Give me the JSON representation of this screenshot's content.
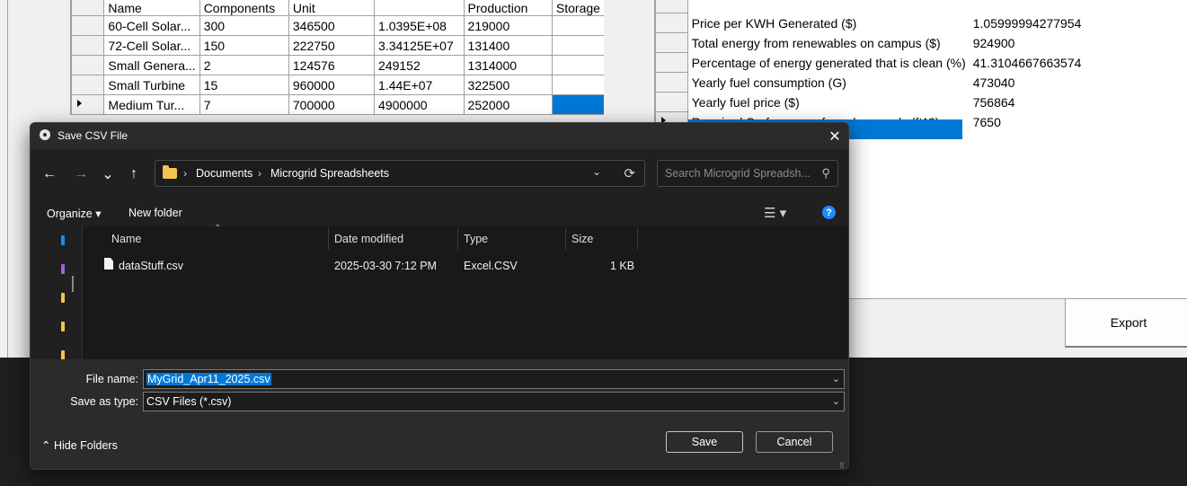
{
  "app": {
    "components_table": {
      "headers": [
        "",
        "Name",
        "Components",
        "Unit",
        "",
        "Production",
        "Storage"
      ],
      "rows": [
        [
          "60-Cell Solar...",
          "300",
          "346500",
          "1.0395E+08",
          "219000",
          ""
        ],
        [
          "72-Cell Solar...",
          "150",
          "222750",
          "3.34125E+07",
          "131400",
          ""
        ],
        [
          "Small Genera...",
          "2",
          "124576",
          "249152",
          "1314000",
          ""
        ],
        [
          "Small Turbine",
          "15",
          "960000",
          "1.44E+07",
          "322500",
          ""
        ],
        [
          "Medium Tur...",
          "7",
          "700000",
          "4900000",
          "252000",
          ""
        ]
      ],
      "current_row_index": 4
    },
    "stats_table": {
      "rows": [
        [
          "Price per KWH Generated ($)",
          "1.05999994277954"
        ],
        [
          "Total energy from renewables on campus ($)",
          "924900"
        ],
        [
          "Percentage of energy generated that is clean (%)",
          "41.3104667663574"
        ],
        [
          "Yearly fuel consumption (G)",
          "473040"
        ],
        [
          "Yearly fuel price ($)",
          "756864"
        ],
        [
          "Required Surface area for solar panels (ft^2)",
          "7650"
        ]
      ],
      "current_row_index": 5
    },
    "export_label": "Export"
  },
  "dialog": {
    "title": "Save CSV File",
    "close_glyph": "✕",
    "nav": {
      "back": "←",
      "forward": "→",
      "recent": "⌄",
      "up": "↑"
    },
    "breadcrumb": [
      "Documents",
      "Microgrid Spreadsheets"
    ],
    "breadcrumb_sep": "›",
    "search_placeholder": "Search Microgrid Spreadsh...",
    "toolbar": {
      "organize": "Organize ▾",
      "new_folder": "New folder",
      "help": "?"
    },
    "columns": {
      "name": "Name",
      "date": "Date modified",
      "type": "Type",
      "size": "Size"
    },
    "files": [
      {
        "name": "dataStuff.csv",
        "date": "2025-03-30 7:12 PM",
        "type": "Excel.CSV",
        "size": "1 KB"
      }
    ],
    "file_name_label": "File name:",
    "file_name_value": "MyGrid_Apr11_2025.csv",
    "save_type_label": "Save as type:",
    "save_type_value": "CSV Files (*.csv)",
    "hide_folders": "Hide Folders",
    "save_label": "Save",
    "cancel_label": "Cancel",
    "nav_icon_colors": [
      "#1a8cff",
      "#a35de6",
      "#f4c44e",
      "#f4c44e",
      "#f4c44e"
    ]
  }
}
